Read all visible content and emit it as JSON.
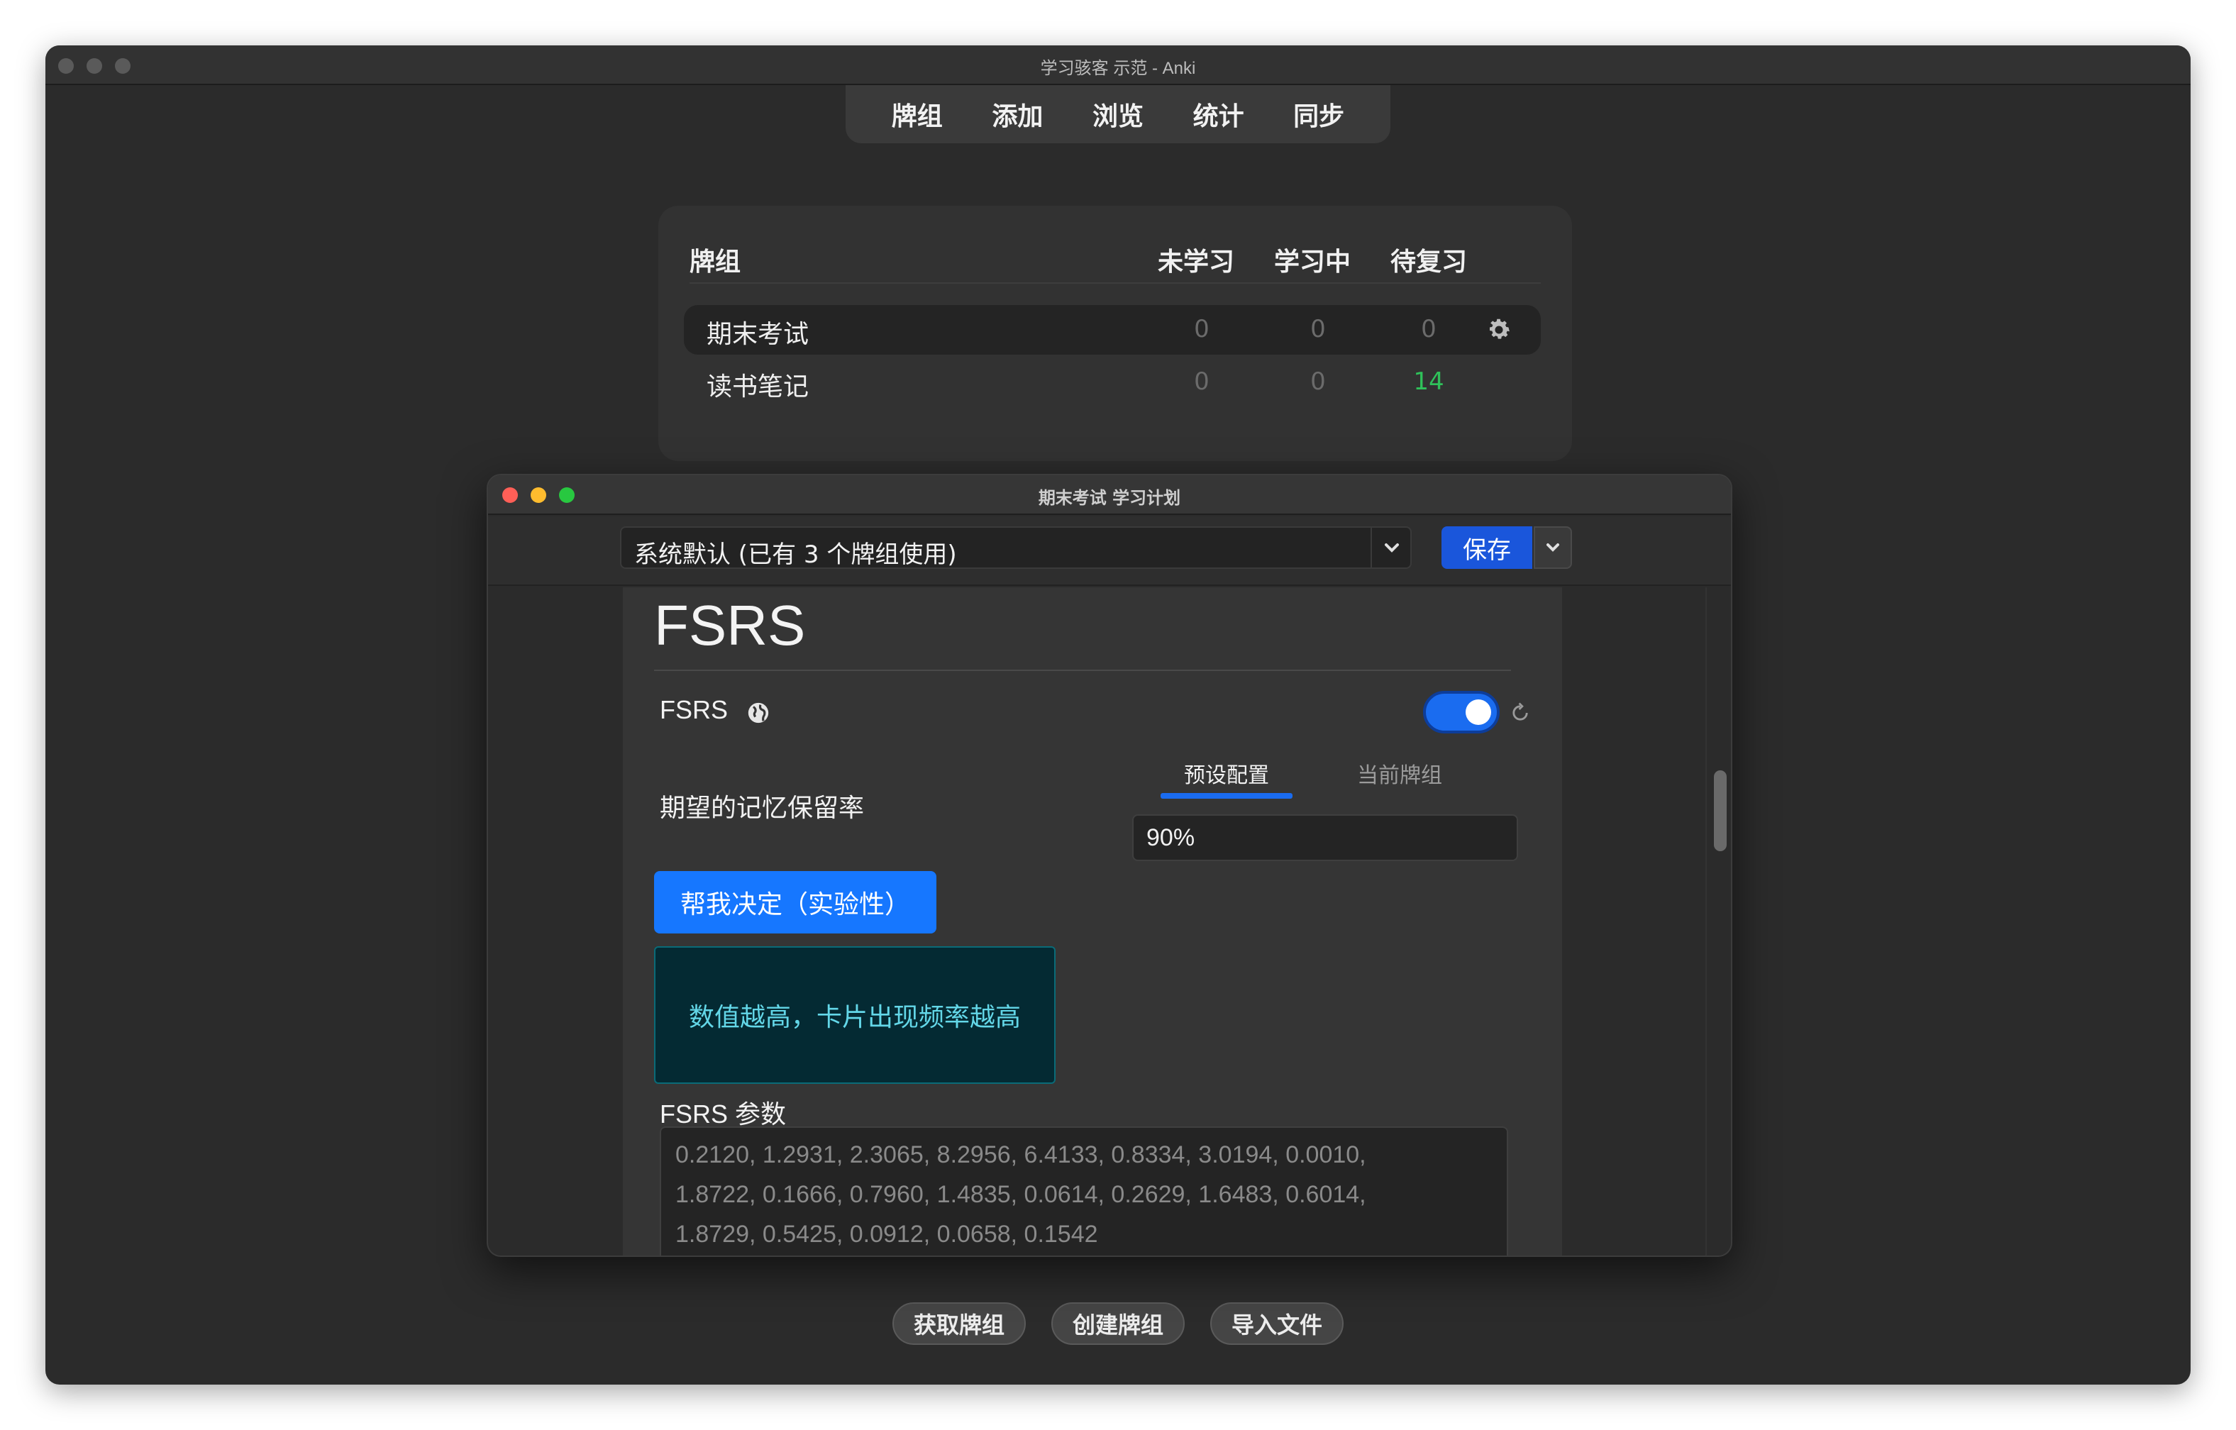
{
  "main_window": {
    "title": "学习骇客 示范 - Anki"
  },
  "toolbar": {
    "items": [
      "牌组",
      "添加",
      "浏览",
      "统计",
      "同步"
    ]
  },
  "deck_list": {
    "headers": {
      "deck": "牌组",
      "new": "未学习",
      "learning": "学习中",
      "due": "待复习"
    },
    "rows": [
      {
        "name": "期末考试",
        "new": "0",
        "learning": "0",
        "due": "0",
        "current": true
      },
      {
        "name": "读书笔记",
        "new": "0",
        "learning": "0",
        "due": "14",
        "current": false
      }
    ]
  },
  "bottom_buttons": {
    "get_shared": "获取牌组",
    "create_deck": "创建牌组",
    "import_file": "导入文件"
  },
  "dialog": {
    "title": "期末考试 学习计划",
    "preset_select": {
      "value": "系统默认 (已有 3 个牌组使用)"
    },
    "save_label": "保存",
    "section_title": "FSRS",
    "fsrs_toggle": {
      "label": "FSRS",
      "enabled": true
    },
    "tabs": {
      "preset": "预设配置",
      "current_deck": "当前牌组",
      "active": "preset"
    },
    "retention": {
      "label": "期望的记忆保留率",
      "value": "90%"
    },
    "help_button_label": "帮我决定（实验性）",
    "tooltip_text": "数值越高，卡片出现频率越高",
    "params": {
      "label": "FSRS 参数",
      "line1": "0.2120, 1.2931, 2.3065, 8.2956, 6.4133, 0.8334, 3.0194, 0.0010,",
      "line2": "1.8722, 0.1666, 0.7960, 1.4835, 0.0614, 0.2629, 1.6483, 0.6014,",
      "line3": "1.8729, 0.5425, 0.0912, 0.0658, 0.1542"
    }
  },
  "colors": {
    "accent": "#1a6cf0",
    "save": "#1a56db",
    "due_green": "#2fc15a",
    "tooltip_text": "#63d7e8"
  },
  "icons": {
    "gear": "gear-icon",
    "globe": "globe-icon",
    "reset": "reset-icon",
    "chevron": "chevron-down-icon"
  }
}
